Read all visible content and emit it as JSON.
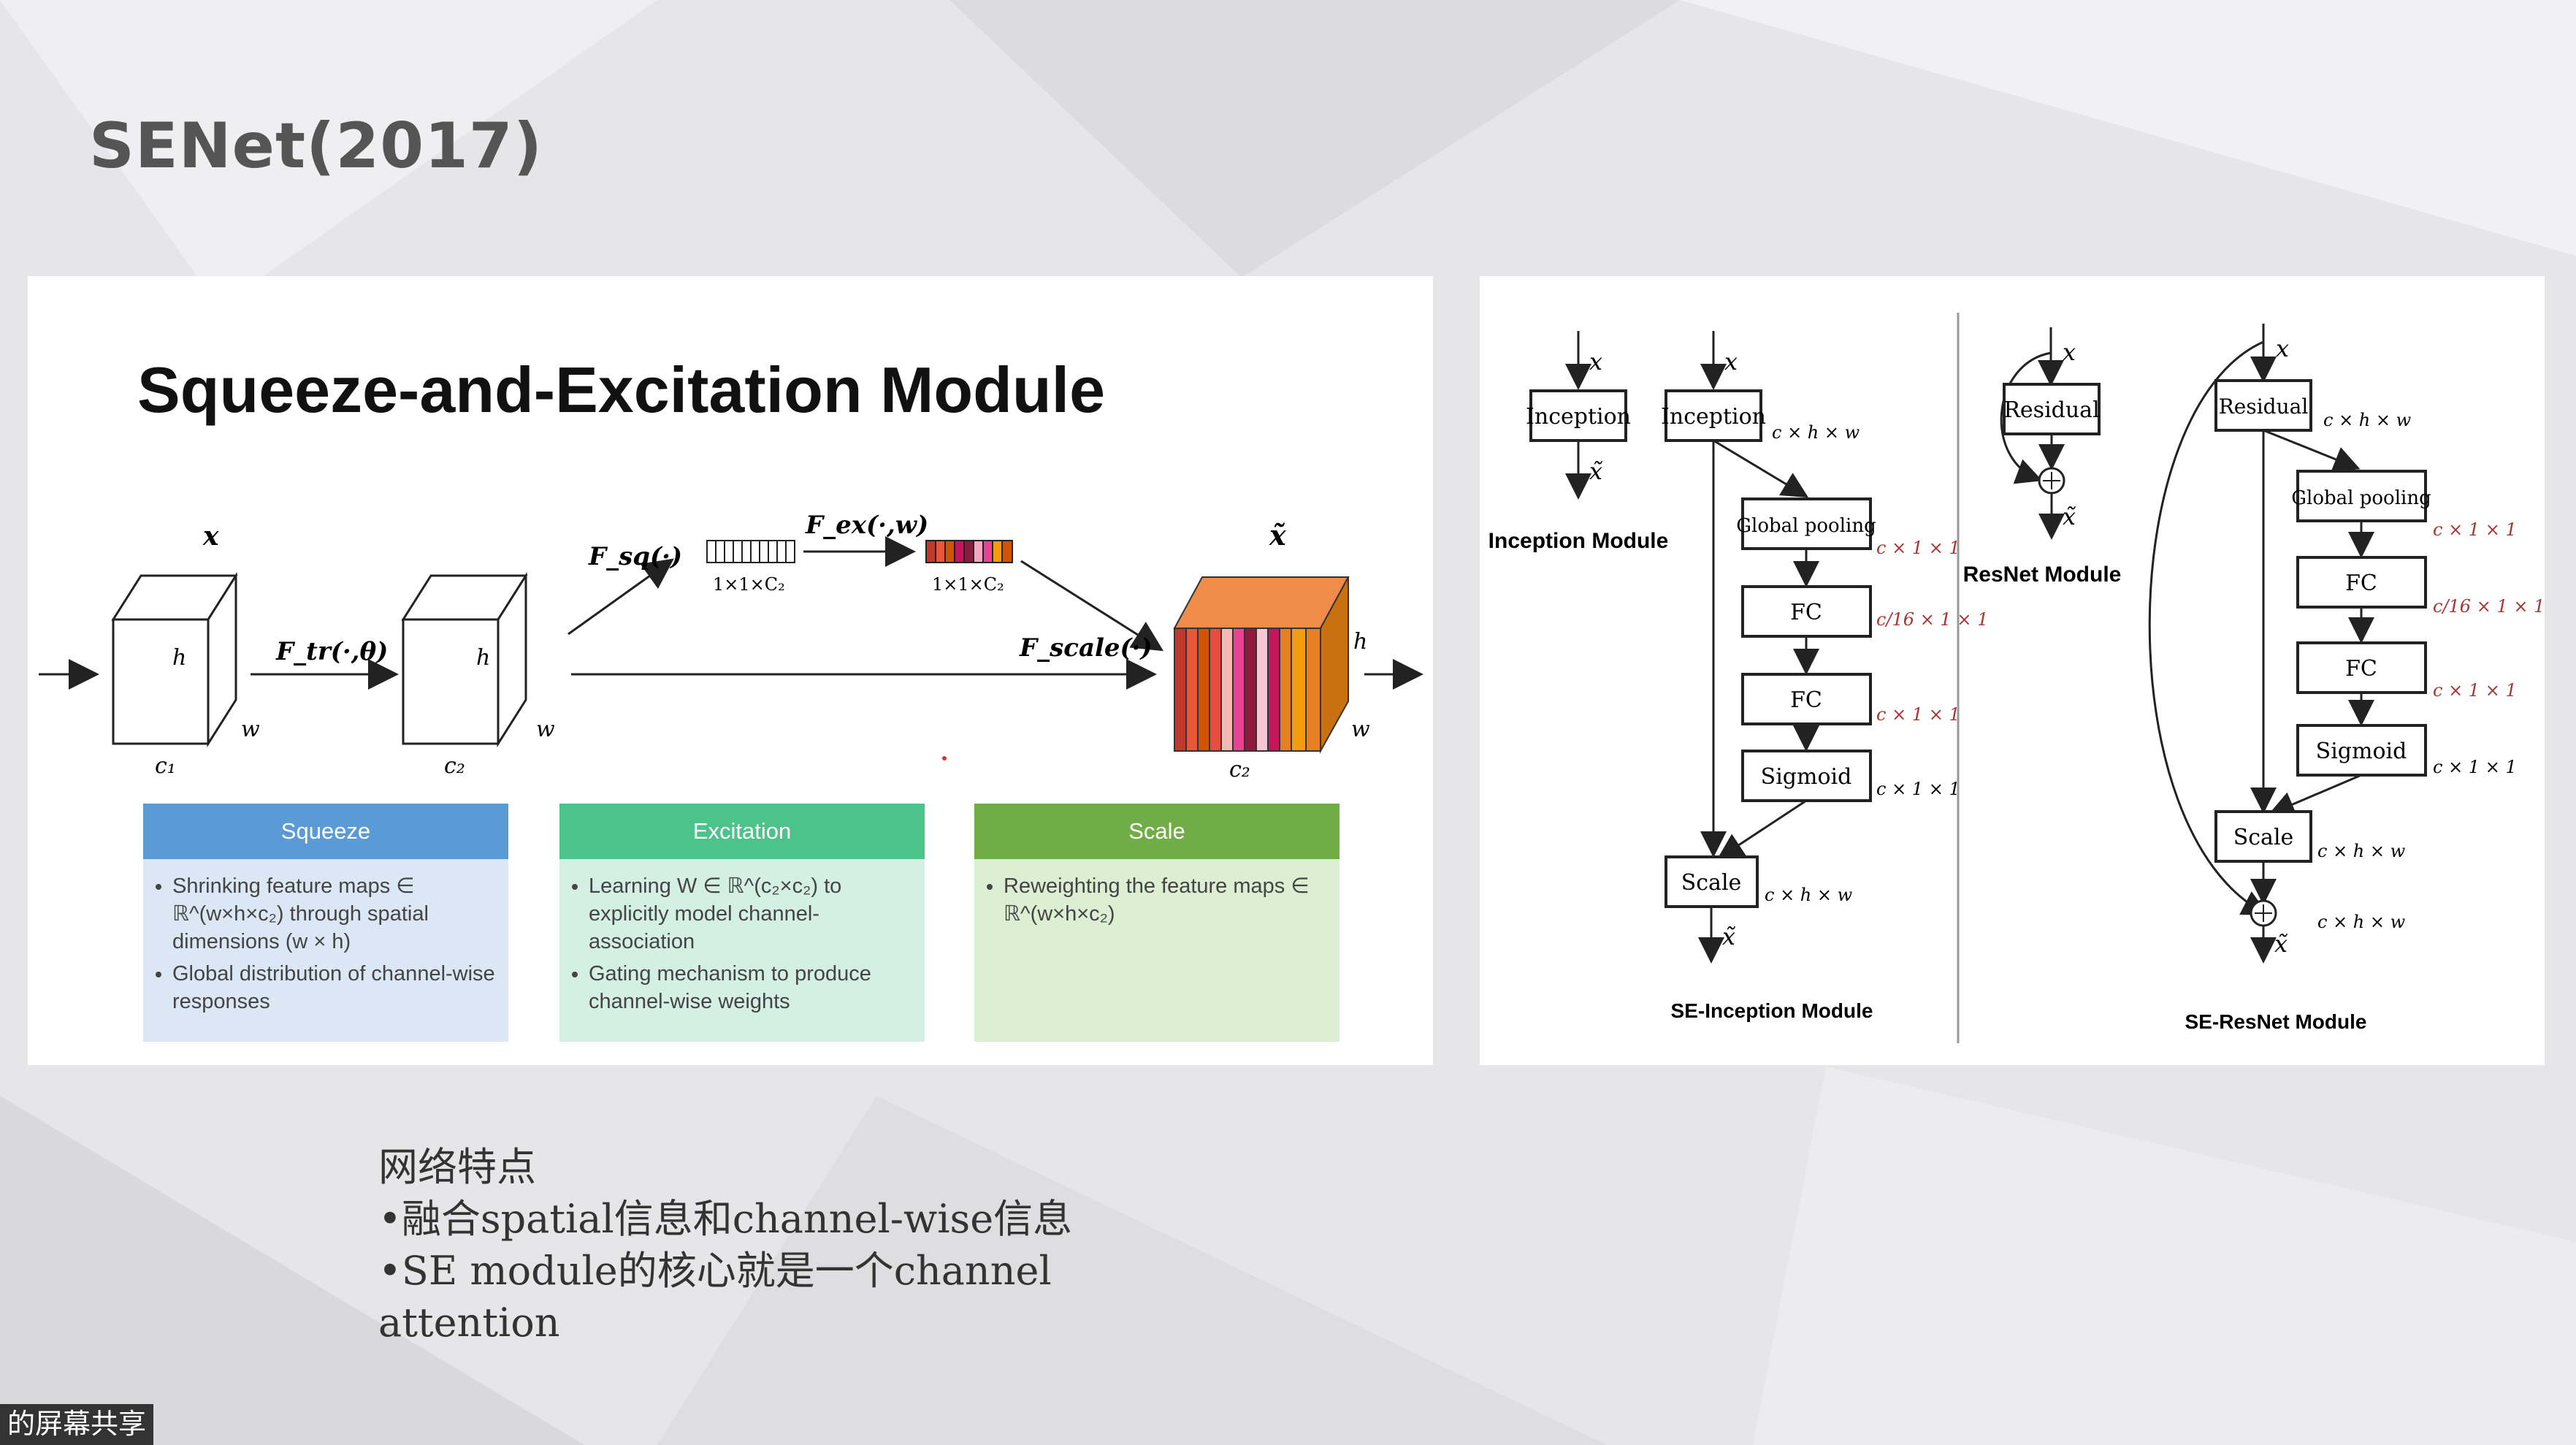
{
  "slide": {
    "title": "SENet(2017)"
  },
  "se_module": {
    "title": "Squeeze-and-Excitation Module",
    "labels": {
      "x": "x",
      "x_tilde": "x̃",
      "h": "h",
      "w": "w",
      "c1": "c₁",
      "c2": "c₂",
      "f_tr": "F_tr(·,θ)",
      "f_sq": "F_sq(·)",
      "f_ex": "F_ex(·,w)",
      "f_scale": "F_scale(·)",
      "size_1x1xc2_a": "1×1×C₂",
      "size_1x1xc2_b": "1×1×C₂"
    },
    "cards": [
      {
        "title": "Squeeze",
        "bullets": [
          "Shrinking feature maps ∈ ℝ^(w×h×c₂) through spatial dimensions (w × h)",
          "Global distribution of channel-wise responses"
        ]
      },
      {
        "title": "Excitation",
        "bullets": [
          "Learning W ∈ ℝ^(c₂×c₂) to explicitly model channel-association",
          "Gating mechanism to produce channel-wise weights"
        ]
      },
      {
        "title": "Scale",
        "bullets": [
          "Reweighting the feature maps ∈ ℝ^(w×h×c₂)"
        ]
      }
    ],
    "colors": {
      "squeeze": "#5b9bd5",
      "excitation": "#4cc38a",
      "scale": "#70ad47"
    }
  },
  "architectures": {
    "inception": {
      "caption": "Inception Module",
      "block": "Inception",
      "x": "x",
      "x_tilde": "x̃"
    },
    "se_inception": {
      "caption": "SE-Inception Module",
      "blocks": [
        "Inception",
        "Global pooling",
        "FC",
        "FC",
        "Sigmoid",
        "Scale"
      ],
      "dims": [
        "c × h × w",
        "c × 1 × 1",
        "c/16 × 1 × 1",
        "c × 1 × 1",
        "c × 1 × 1",
        "c × h × w"
      ],
      "x": "x",
      "x_tilde": "x̃"
    },
    "resnet": {
      "caption": "ResNet Module",
      "block": "Residual",
      "x": "x",
      "x_tilde": "x̃"
    },
    "se_resnet": {
      "caption": "SE-ResNet Module",
      "blocks": [
        "Residual",
        "Global pooling",
        "FC",
        "FC",
        "Sigmoid",
        "Scale"
      ],
      "dims": [
        "c × h × w",
        "c × 1 × 1",
        "c/16 × 1 × 1",
        "c × 1 × 1",
        "c × 1 × 1",
        "c × h × w",
        "c × h × w"
      ],
      "x": "x",
      "x_tilde": "x̃"
    }
  },
  "notes": {
    "heading": "网络特点",
    "line1": "•融合spatial信息和channel-wise信息",
    "line2": "•SE module的核心就是一个channel",
    "line3": "attention"
  },
  "screen_share": {
    "label": "的屏幕共享"
  }
}
